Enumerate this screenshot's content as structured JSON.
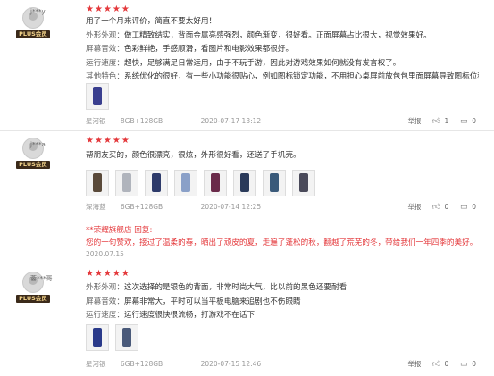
{
  "reviews": [
    {
      "username": "j***y",
      "badge": "PLUS会员",
      "stars": "★★★★★",
      "lines": [
        {
          "label": "",
          "text": "用了一个月来评价，简直不要太好用！"
        },
        {
          "label": "外形外观：",
          "text": "做工精致结实，背面金属亮感强烈，颜色渐变，很好看。正面屏幕占比很大，视觉效果好。"
        },
        {
          "label": "屏幕音效：",
          "text": "色彩鲜艳，手感顺滑，看图片和电影效果都很好。"
        },
        {
          "label": "运行速度：",
          "text": "超快，足够满足日常运用，由于不玩手游，因此对游戏效果如何就没有发言权了。"
        },
        {
          "label": "其他特色：",
          "text": "系统优化的很好，有一些小功能很贴心，例如图标锁定功能，不用担心桌屏前放包包里面屏幕导致图标位移或删除……"
        }
      ],
      "thumb_colors": [
        "#3a3f8f"
      ],
      "color": "星河银",
      "spec": "8GB+128GB",
      "date": "2020-07-17 13:12",
      "report": "举报",
      "likes": "1",
      "comments": "0"
    },
    {
      "username": "j***a",
      "badge": "PLUS会员",
      "stars": "★★★★★",
      "lines": [
        {
          "label": "",
          "text": "帮朋友买的，颜色很漂亮，很炫，外形很好看，还送了手机壳。"
        }
      ],
      "thumb_colors": [
        "#5a4a3a",
        "#b0b4bc",
        "#2d3a6a",
        "#8aa0c8",
        "#6a2a4a",
        "#2a3a5a",
        "#3a5a7a",
        "#4a4a5a"
      ],
      "color": "深海蓝",
      "spec": "6GB+128GB",
      "date": "2020-07-14 12:25",
      "report": "举报",
      "likes": "0",
      "comments": "0",
      "reply": {
        "head": "**荣耀旗舰店 回复:",
        "body": "您的一句赞欢，接过了温柔的春，晒出了顽皮的夏，走遍了蓬松的秋，翻越了荒芜的冬，带给我们一年四季的美好。",
        "date": "2020.07.15"
      }
    },
    {
      "username": "蓉***哥",
      "badge": "PLUS会员",
      "stars": "★★★★★",
      "lines": [
        {
          "label": "外形外观：",
          "text": "这次选择的是银色的背面，非常时尚大气，比以前的黑色还要耐看"
        },
        {
          "label": "屏幕音效：",
          "text": "屏幕非常大，平时可以当平板电脑来追剧也不伤眼睛"
        },
        {
          "label": "运行速度：",
          "text": "运行速度很快很流畅，打游戏不在话下"
        }
      ],
      "thumb_colors": [
        "#2a3a8a",
        "#4a5a7a"
      ],
      "color": "星河银",
      "spec": "6GB+128GB",
      "date": "2020-07-15 12:46",
      "report": "举报",
      "likes": "0",
      "comments": "0"
    }
  ],
  "icons": {
    "like": "thumbs-up-icon",
    "comment": "comment-icon"
  }
}
